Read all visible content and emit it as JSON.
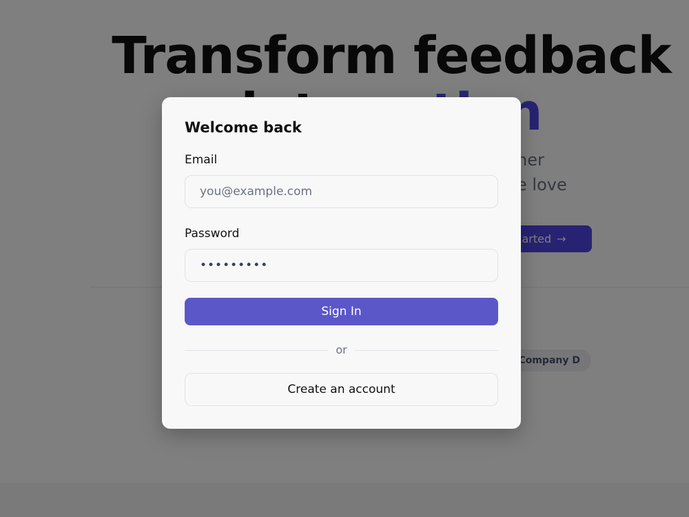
{
  "background": {
    "hero": {
      "line1": "Transform feedback",
      "line2_prefix": "into ",
      "line2_accent": "action"
    },
    "subtitle": {
      "line1": "ner",
      "line2": "e love"
    },
    "cta": {
      "label": "arted",
      "arrow": "→"
    },
    "logo_pill": "Company D"
  },
  "modal": {
    "title": "Welcome back",
    "email": {
      "label": "Email",
      "placeholder": "you@example.com",
      "value": ""
    },
    "password": {
      "label": "Password",
      "value": "•••••••••"
    },
    "sign_in_label": "Sign In",
    "or_label": "or",
    "create_account_label": "Create an account"
  },
  "colors": {
    "accent": "#5b57c9",
    "brand": "#4f46e5",
    "overlay": "rgba(0,0,0,0.5)"
  }
}
